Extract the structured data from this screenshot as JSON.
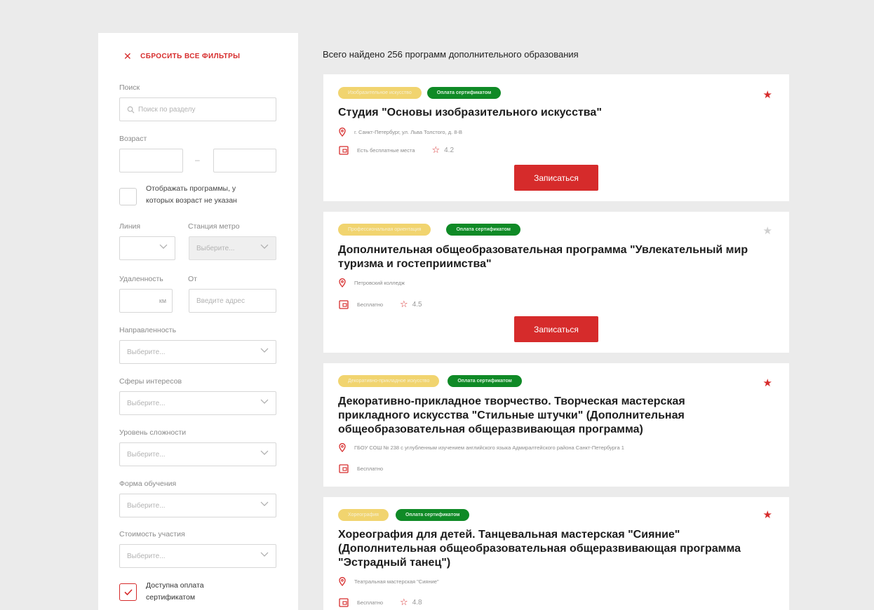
{
  "sidebar": {
    "reset_label": "СБРОСИТЬ ВСЕ ФИЛЬТРЫ",
    "search_label": "Поиск",
    "search_placeholder": "Поиск по разделу",
    "age_label": "Возраст",
    "age_dash": "–",
    "show_no_age_label": "Отображать программы, у которых возраст не указан",
    "line_label": "Линия",
    "metro_label": "Станция метро",
    "metro_placeholder": "Выберите...",
    "distance_label": "Удаленность",
    "from_label": "От",
    "km_unit": "км",
    "address_placeholder": "Введите адрес",
    "direction_label": "Направленность",
    "interests_label": "Сферы интересов",
    "level_label": "Уровень сложности",
    "form_label": "Форма обучения",
    "cost_label": "Стоимость участия",
    "select_placeholder": "Выберите...",
    "certificate_label": "Доступна оплата сертификатом"
  },
  "main": {
    "found_text": "Всего найдено 256 программ дополнительного образования",
    "cards": [
      {
        "tag1": "Изобразительное искусство",
        "tag2": "Оплата сертификатом",
        "title": "Студия \"Основы изобразительного искусства\"",
        "address": "г. Санкт-Петербург, ул. Льва Толстого, д. 8-В",
        "price": "Есть бесплатные места",
        "rating": "4.2",
        "button": "Записаться",
        "favorite": true
      },
      {
        "tag1": "Профессиональная ориентация",
        "tag2": "Оплата сертификатом",
        "title": "Дополнительная общеобразовательная программа \"Увлекательный мир туризма и гостеприимства\"",
        "address": "Петровский колледж",
        "price": "Бесплатно",
        "rating": "4.5",
        "button": "Записаться",
        "favorite": false
      },
      {
        "tag1": "Декоративно-прикладное искусство",
        "tag2": "Оплата сертификатом",
        "title": "Декоративно-прикладное творчество. Творческая мастерская прикладного искусства \"Стильные штучки\" (Дополнительная общеобразовательная общеразвивающая программа)",
        "address": "ГБОУ СОШ № 238 с углубленным изучением английского языка Адмиралтейского района Санкт-Петербурга 1",
        "price": "Бесплатно",
        "favorite": true
      },
      {
        "tag1": "Хореография",
        "tag2": "Оплата сертификатом",
        "title": "Хореография для детей. Танцевальная мастерская \"Сияние\" (Дополнительная общеобразовательная общеразвивающая программа \"Эстрадный танец\")",
        "address": "Театральная мастерская \"Сияние\"",
        "price": "Бесплатно",
        "rating": "4.8",
        "favorite": true
      }
    ]
  },
  "colors": {
    "accent": "#d62b2b",
    "tag_yellow": "#f1d46f",
    "tag_green": "#0f8a26",
    "background": "#ebebeb"
  }
}
